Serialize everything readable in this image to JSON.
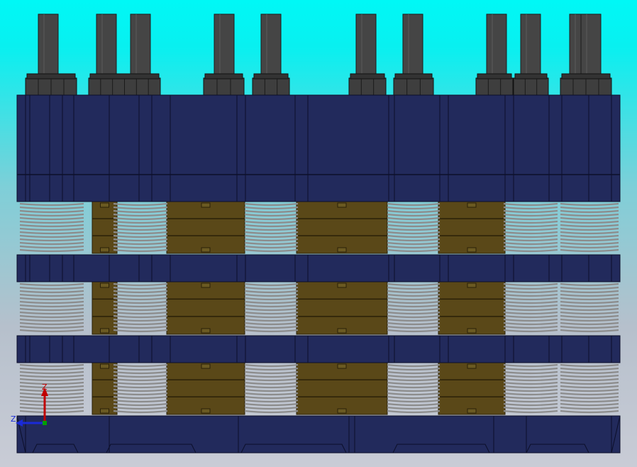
{
  "app": {
    "viewport_name": "3D CAD viewport",
    "background_top": "#00f8f6",
    "background_bottom": "#c9ccd6"
  },
  "model": {
    "plate_color": "#222a5c",
    "block_color": "#5a4818",
    "spring_color": "#8c8c8c",
    "stud_color": "#454545",
    "nut_color": "#3e3e3e"
  },
  "triad": {
    "z_label": "Z",
    "x_label": "Z",
    "z_color": "#c00000",
    "x_color": "#1a2ad8",
    "origin_color": "#00a000"
  }
}
